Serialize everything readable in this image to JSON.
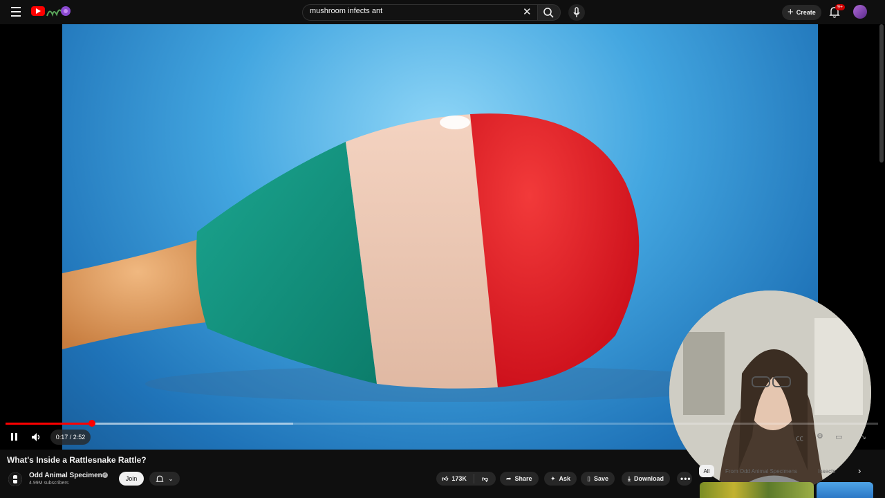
{
  "search": {
    "query": "mushroom infects ant"
  },
  "header": {
    "create_label": "Create",
    "notification_count": "9+"
  },
  "player": {
    "time_display": "0:17 / 2:52",
    "progress": 0.099,
    "buffered": 0.33
  },
  "video": {
    "title": "What's Inside a Rattlesnake Rattle?"
  },
  "channel": {
    "name": "Odd Animal Specimens",
    "subscribers": "4.99M subscribers",
    "join_label": "Join"
  },
  "actions": {
    "likes": "173K",
    "share_label": "Share",
    "ask_label": "Ask",
    "save_label": "Save",
    "download_label": "Download"
  },
  "chips": {
    "all": "All",
    "from_channel": "From Odd Animal Specimens",
    "insects": "Insects"
  },
  "colors": {
    "brand_red": "#ff0000",
    "background": "#0f0f0f",
    "pill": "#272727"
  }
}
